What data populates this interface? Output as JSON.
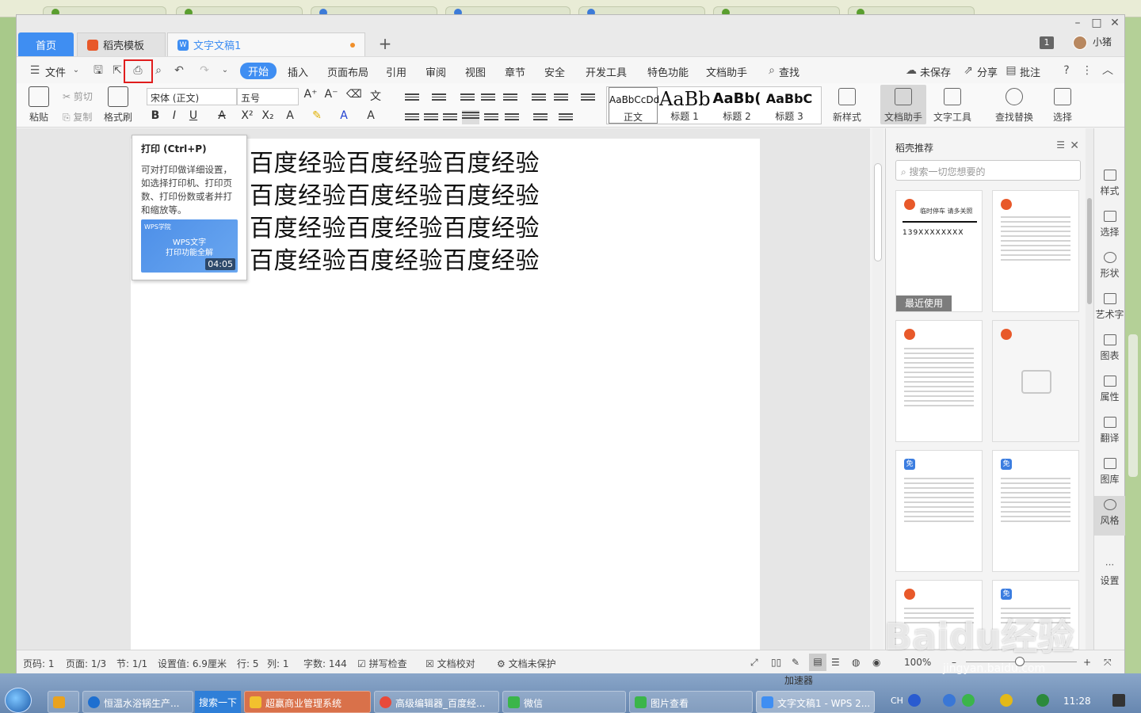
{
  "window": {
    "tabs": [
      {
        "label": "首页"
      },
      {
        "label": "稻壳模板"
      },
      {
        "label": "文字文稿1"
      }
    ],
    "tab_count": "1",
    "user_name": "小猪"
  },
  "menu": {
    "file": "文件",
    "items": [
      "开始",
      "插入",
      "页面布局",
      "引用",
      "审阅",
      "视图",
      "章节",
      "安全",
      "开发工具",
      "特色功能",
      "文档助手"
    ],
    "search": "查找",
    "unsaved": "未保存",
    "share": "分享",
    "comment": "批注"
  },
  "ribbon": {
    "paste": "粘贴",
    "cut": "剪切",
    "copy": "复制",
    "format_painter": "格式刷",
    "font_family": "宋体 (正文)",
    "font_size": "五号",
    "styles": [
      {
        "preview": "AaBbCcDd",
        "name": "正文"
      },
      {
        "preview": "AaBb",
        "name": "标题 1"
      },
      {
        "preview": "AaBb(",
        "name": "标题 2"
      },
      {
        "preview": "AaBbC",
        "name": "标题 3"
      }
    ],
    "new_style": "新样式",
    "doc_assistant": "文档助手",
    "text_tools": "文字工具",
    "find_replace": "查找替换",
    "select": "选择"
  },
  "tooltip": {
    "title": "打印 (Ctrl+P)",
    "body": "可对打印做详细设置，如选择打印机、打印页数、打印份数或者并打和缩放等。",
    "video_title_1": "WPS文字",
    "video_title_2": "打印功能全解",
    "video_logo": "WPS学院",
    "video_duration": "04:05"
  },
  "document": {
    "lines": [
      "百度经验百度经验百度经验",
      "百度经验百度经验百度经验",
      "百度经验百度经验百度经验",
      "百度经验百度经验百度经验"
    ]
  },
  "panel": {
    "title": "稻壳推荐",
    "search_placeholder": "搜索一切您想要的",
    "recent_label": "最近使用",
    "card1_header": "临时停车  请多关照",
    "card1_phone": "139XXXXXXXX"
  },
  "right_tools": [
    "样式",
    "选择",
    "形状",
    "艺术字",
    "图表",
    "属性",
    "翻译",
    "图库",
    "风格",
    "设置"
  ],
  "status": {
    "page_num": "页码: 1",
    "pages": "页面: 1/3",
    "section": "节: 1/1",
    "setting": "设置值: 6.9厘米",
    "row": "行: 5",
    "col": "列: 1",
    "word_count": "字数: 144",
    "spellcheck": "拼写检查",
    "proofread": "文档校对",
    "unprotected": "文档未保护",
    "zoom": "100%"
  },
  "taskbar": {
    "items": [
      "恒温水浴锅生产...",
      "超赢商业管理系统",
      "高级编辑器_百度经...",
      "微信",
      "图片查看",
      "文字文稿1 - WPS 2..."
    ],
    "search_button": "搜索一下",
    "accelerator": "加速器",
    "clock": "11:28",
    "lang": "CH"
  },
  "watermark": {
    "brand": "Baidu经验",
    "url": "jingyan.baidu.com"
  },
  "colors": {
    "accent": "#3f8ef2",
    "highlight": "#e01d1d",
    "doc_tab_text": "#3f8ef2"
  }
}
